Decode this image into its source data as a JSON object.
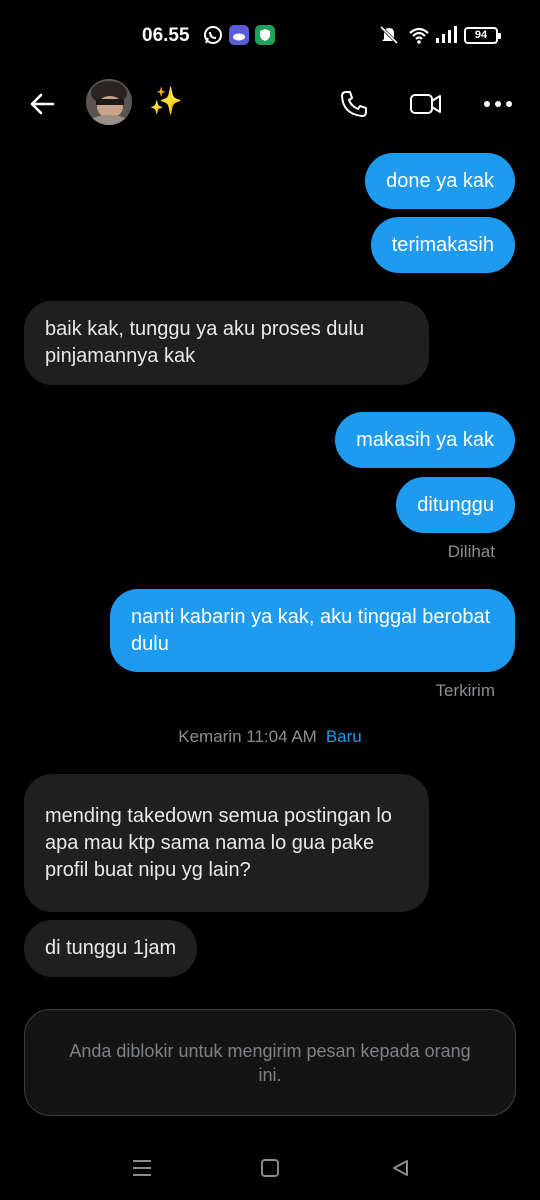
{
  "status_bar": {
    "time": "06.55",
    "battery": "94"
  },
  "header": {
    "name": "✨",
    "icons": [
      "back-arrow-icon",
      "phone-icon",
      "video-icon",
      "more-icon"
    ]
  },
  "messages": [
    {
      "dir": "out",
      "text": "done ya kak"
    },
    {
      "dir": "out",
      "text": "terimakasih"
    },
    {
      "dir": "in",
      "text": "baik kak, tunggu ya aku proses dulu pinjamannya kak"
    },
    {
      "dir": "out",
      "text": "makasih ya kak"
    },
    {
      "dir": "out",
      "text": "ditunggu"
    },
    {
      "dir": "out",
      "text": "nanti kabarin ya kak, aku tinggal berobat dulu"
    },
    {
      "dir": "in",
      "text": "mending takedown semua postingan lo apa mau ktp sama nama lo gua pake profil buat nipu yg lain?"
    },
    {
      "dir": "in",
      "text": "di tunggu 1jam"
    }
  ],
  "read_status": "Dilihat",
  "sent_status": "Terkirim",
  "timestamp": {
    "time": "Kemarin 11:04 AM",
    "new_label": "Baru"
  },
  "blocked_notice": "Anda diblokir untuk mengirim pesan kepada orang ini.",
  "colors": {
    "outgoing": "#1d9bf0",
    "incoming": "#1f1f1f",
    "background": "#000000"
  }
}
